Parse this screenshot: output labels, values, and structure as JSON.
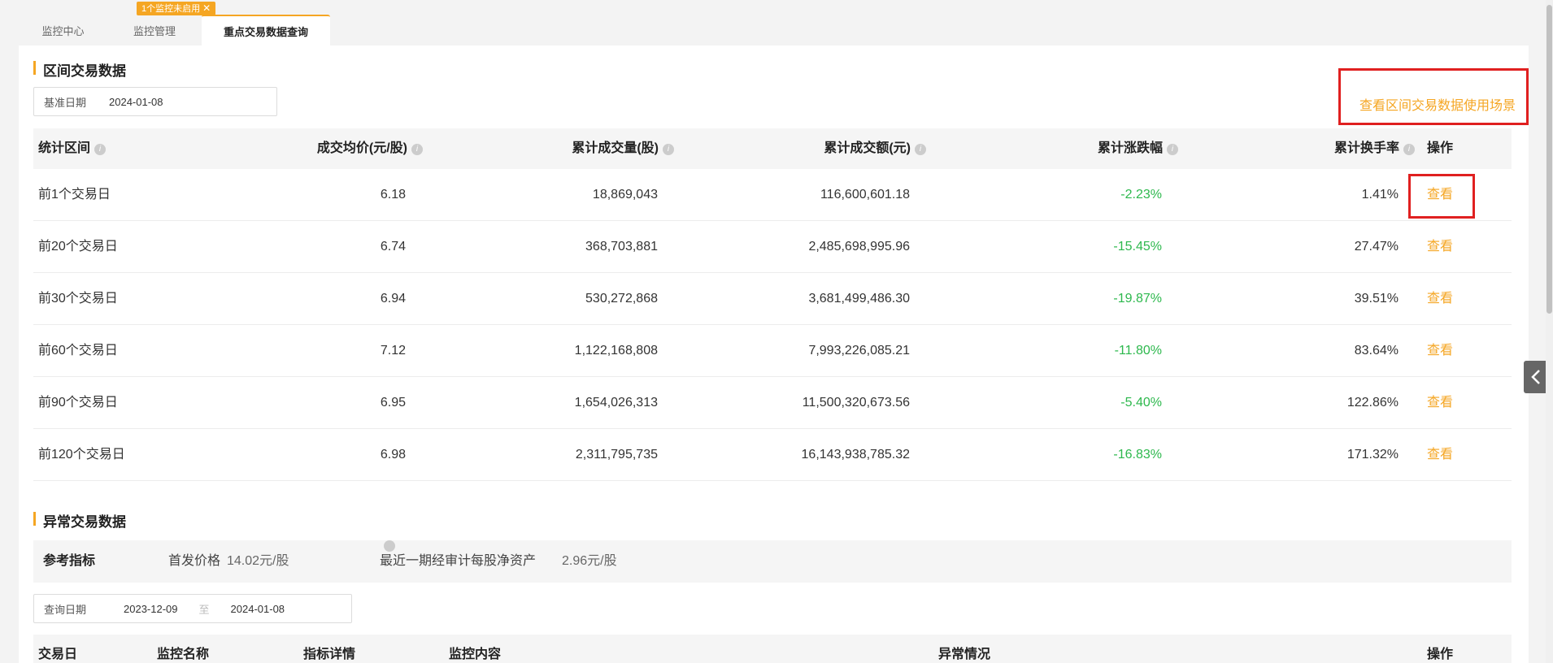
{
  "tabs": [
    {
      "label": "监控中心"
    },
    {
      "label": "监控管理"
    },
    {
      "label": "重点交易数据查询"
    }
  ],
  "badge": {
    "label": "1个监控未启用",
    "close": "✕"
  },
  "interval": {
    "title": "区间交易数据",
    "base_date_label": "基准日期",
    "base_date": "2024-01-08",
    "scene_link": "查看区间交易数据使用场景",
    "columns": [
      "统计区间",
      "成交均价(元/股)",
      "累计成交量(股)",
      "累计成交额(元)",
      "累计涨跌幅",
      "累计换手率",
      "操作"
    ],
    "rows": [
      {
        "period": "前1个交易日",
        "avg_price": "6.18",
        "volume": "18,869,043",
        "amount": "116,600,601.18",
        "change": "-2.23%",
        "turnover": "1.41%",
        "action": "查看"
      },
      {
        "period": "前20个交易日",
        "avg_price": "6.74",
        "volume": "368,703,881",
        "amount": "2,485,698,995.96",
        "change": "-15.45%",
        "turnover": "27.47%",
        "action": "查看"
      },
      {
        "period": "前30个交易日",
        "avg_price": "6.94",
        "volume": "530,272,868",
        "amount": "3,681,499,486.30",
        "change": "-19.87%",
        "turnover": "39.51%",
        "action": "查看"
      },
      {
        "period": "前60个交易日",
        "avg_price": "7.12",
        "volume": "1,122,168,808",
        "amount": "7,993,226,085.21",
        "change": "-11.80%",
        "turnover": "83.64%",
        "action": "查看"
      },
      {
        "period": "前90个交易日",
        "avg_price": "6.95",
        "volume": "1,654,026,313",
        "amount": "11,500,320,673.56",
        "change": "-5.40%",
        "turnover": "122.86%",
        "action": "查看"
      },
      {
        "period": "前120个交易日",
        "avg_price": "6.98",
        "volume": "2,311,795,735",
        "amount": "16,143,938,785.32",
        "change": "-16.83%",
        "turnover": "171.32%",
        "action": "查看"
      }
    ]
  },
  "abnormal": {
    "title": "异常交易数据",
    "ref_label": "参考指标",
    "issue_price_label": "首发价格",
    "issue_price": "14.02元/股",
    "nav_label": "最近一期经审计每股净资产",
    "nav": "2.96元/股",
    "query_label": "查询日期",
    "start_date": "2023-12-09",
    "to": "至",
    "end_date": "2024-01-08",
    "columns": [
      "交易日",
      "监控名称",
      "指标详情",
      "监控内容",
      "异常情况",
      "操作"
    ]
  },
  "colors": {
    "accent": "#f5a623",
    "negative": "#2db84d",
    "highlight": "#e02020"
  },
  "icons": {
    "info": "info-icon",
    "collapse": "chevron-left-icon"
  }
}
